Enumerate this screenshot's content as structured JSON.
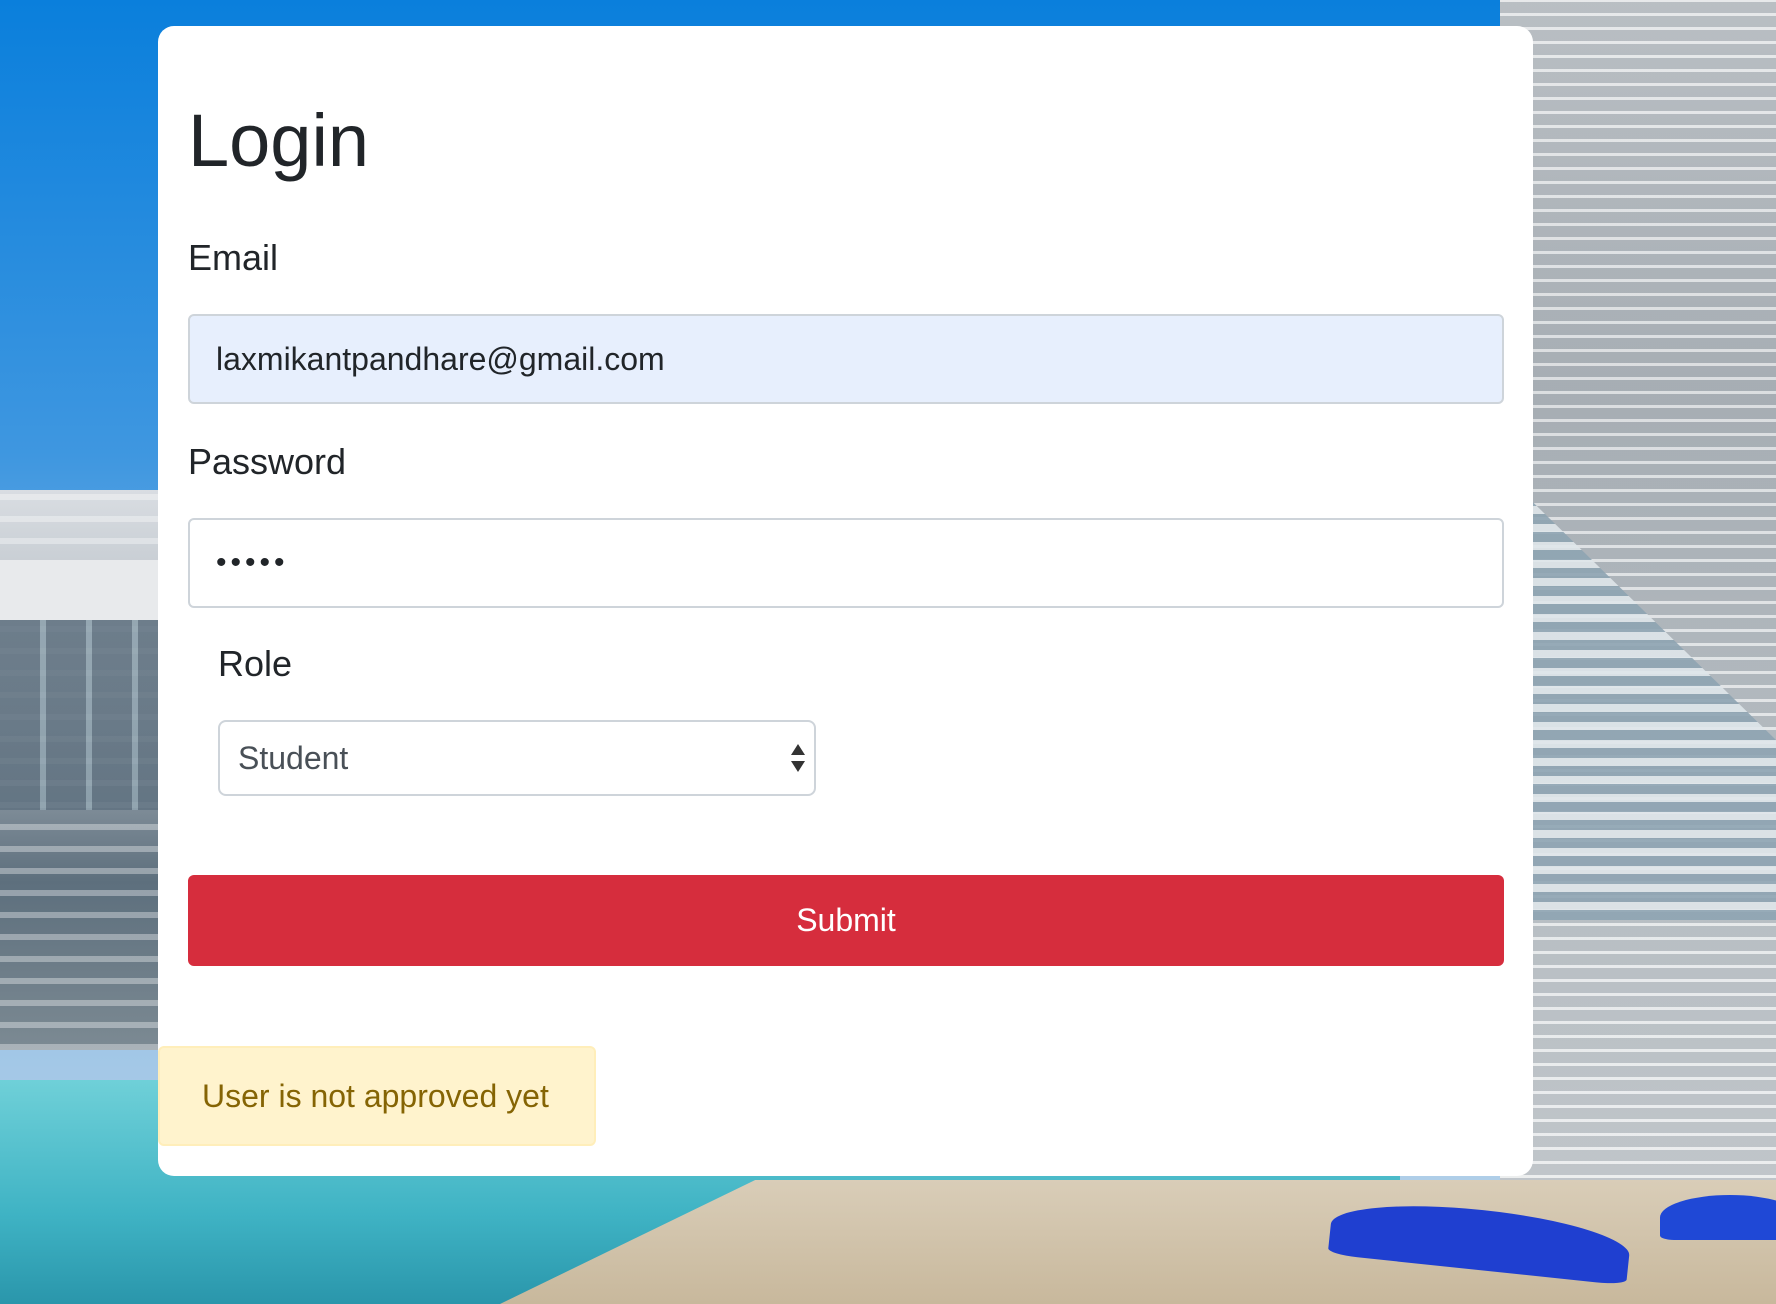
{
  "login": {
    "title": "Login",
    "email": {
      "label": "Email",
      "value": "laxmikantpandhare@gmail.com"
    },
    "password": {
      "label": "Password",
      "masked_value": "•••••"
    },
    "role": {
      "label": "Role",
      "selected": "Student"
    },
    "submit_label": "Submit",
    "alert_message": "User is not approved yet"
  },
  "colors": {
    "submit_background": "#d62d3d",
    "email_field_background": "#e7effd",
    "alert_background": "#fff3cd",
    "alert_text": "#856404"
  }
}
